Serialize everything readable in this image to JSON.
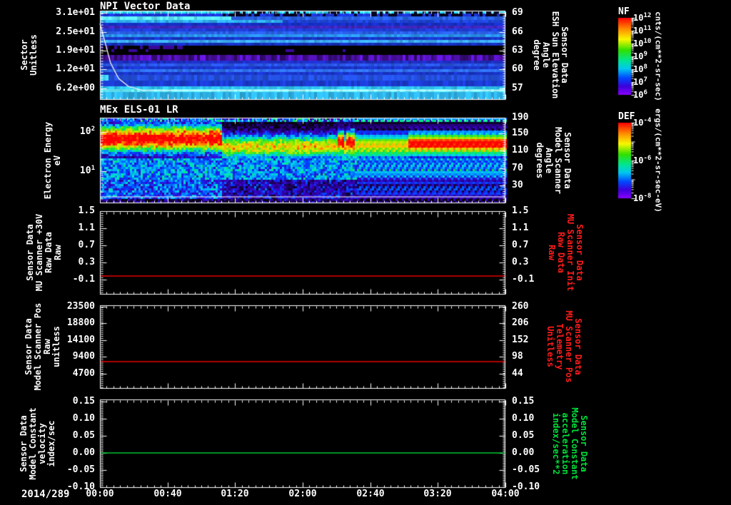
{
  "chart_data": {
    "type": "multi-panel-time-series",
    "time_axis": {
      "date_label": "2014/289",
      "tick_labels": [
        "00:00",
        "00:40",
        "01:20",
        "02:00",
        "02:40",
        "03:20",
        "04:00"
      ],
      "minor_per_major": 10
    },
    "palette": [
      [
        0,
        "#06000a"
      ],
      [
        0.1,
        "#1c0060"
      ],
      [
        0.22,
        "#3a00c8"
      ],
      [
        0.33,
        "#0040ff"
      ],
      [
        0.44,
        "#00b4ff"
      ],
      [
        0.52,
        "#00e6c8"
      ],
      [
        0.6,
        "#00e650"
      ],
      [
        0.7,
        "#7ce800"
      ],
      [
        0.78,
        "#d8ee00"
      ],
      [
        0.86,
        "#ffb400"
      ],
      [
        0.93,
        "#ff5000"
      ],
      [
        1,
        "#ff0000"
      ]
    ],
    "colorbar_gradient": [
      [
        0,
        "#ff0000"
      ],
      [
        0.15,
        "#ff9100"
      ],
      [
        0.28,
        "#f8f800"
      ],
      [
        0.42,
        "#30e000"
      ],
      [
        0.55,
        "#00e690"
      ],
      [
        0.66,
        "#00c8f0"
      ],
      [
        0.78,
        "#0048ff"
      ],
      [
        0.89,
        "#3c00dc"
      ],
      [
        1,
        "#8a00ff"
      ]
    ],
    "colorbars": [
      {
        "title": "NF",
        "units_label": "cnts/(cm**2-sr-sec)",
        "ticks": [
          {
            "label": "10^12",
            "f": 0
          },
          {
            "label": "10^11",
            "f": 0.1667
          },
          {
            "label": "10^10",
            "f": 0.3333
          },
          {
            "label": "10^9",
            "f": 0.5
          },
          {
            "label": "10^8",
            "f": 0.6667
          },
          {
            "label": "10^7",
            "f": 0.8333
          },
          {
            "label": "10^6",
            "f": 1
          }
        ]
      },
      {
        "title": "DEF",
        "units_label": "ergs/(cm**2-sr-sec-eV)",
        "ticks": [
          {
            "label": "10^-4",
            "f": 0
          },
          {
            "label": "10^-6",
            "f": 0.5
          },
          {
            "label": "10^-8",
            "f": 1
          }
        ]
      }
    ],
    "panels": [
      {
        "title": "NPI Vector Data",
        "type": "spectrogram",
        "left_title": "Sector\nUnitless",
        "right_title": "Sensor Data\nESH Sun Elevation\nAngle\ndegree",
        "left_ticks": [
          {
            "label": "3.1e+01",
            "f": 0.024
          },
          {
            "label": "2.5e+01",
            "f": 0.24
          },
          {
            "label": "1.9e+01",
            "f": 0.448
          },
          {
            "label": "1.2e+01",
            "f": 0.656
          },
          {
            "label": "6.2e+00",
            "f": 0.872
          }
        ],
        "right_ticks": [
          {
            "label": "69",
            "f": 0.024
          },
          {
            "label": "66",
            "f": 0.24
          },
          {
            "label": "63",
            "f": 0.448
          },
          {
            "label": "60",
            "f": 0.656
          },
          {
            "label": "57",
            "f": 0.872
          }
        ],
        "rows": [
          {
            "h": 4,
            "c": "#22d2f2",
            "sp": {
              "c": "#000a28",
              "d": 0.55,
              "from": 0.33
            }
          },
          {
            "h": 4,
            "c": "#1b35d8",
            "sp": {
              "c": "#05001e",
              "d": 0.5,
              "from": 0.3
            }
          },
          {
            "h": 5,
            "c": "#5ceaff",
            "c2": "#2a62e8",
            "split": 0.32
          },
          {
            "h": 4,
            "c": "#2fb0f2",
            "c2": "#1e45d8",
            "split": 0.45
          },
          {
            "h": 4,
            "c": "#1530c8"
          },
          {
            "h": 4,
            "c": "#3f28c0"
          },
          {
            "h": 4,
            "c": "#1e3ed8"
          },
          {
            "h": 4,
            "c": "#2a60e8"
          },
          {
            "h": 4,
            "c": "#2b96f2"
          },
          {
            "h": 4,
            "c": "#1636cc"
          },
          {
            "h": 4,
            "c": "#3dacf6"
          },
          {
            "h": 4,
            "c": "#1530bc"
          },
          {
            "h": 5,
            "c": "#000000",
            "sp": {
              "c": "#38089a",
              "d": 0.55,
              "to": 0.23
            }
          },
          {
            "h": 4,
            "c": "#000000",
            "sp": {
              "c": "#38089a",
              "d": 0.1,
              "to": 0.6
            }
          },
          {
            "h": 4,
            "c": "#000000"
          },
          {
            "h": 8,
            "c": "#4c10a8",
            "n": 0.5
          },
          {
            "h": 4,
            "c": "#1d2fc4"
          },
          {
            "h": 4,
            "c": "#2a55e4"
          },
          {
            "h": 4,
            "c": "#1a35cc"
          },
          {
            "h": 4,
            "c": "#2f70f0"
          },
          {
            "h": 4,
            "c": "#1a35cc"
          },
          {
            "h": 8,
            "c": "#2450e0",
            "lead": "#3fd4f8",
            "leadW": 0.018
          },
          {
            "h": 8,
            "c": "#1c3cd4"
          },
          {
            "h": 4,
            "c": "#2fc4f2"
          },
          {
            "h": 4,
            "c": "#63eeff"
          },
          {
            "h": 11,
            "c": "#2fb4ea"
          }
        ],
        "overlay_line": {
          "color": "#ffffff",
          "points": [
            [
              0,
              0.144
            ],
            [
              0.012,
              0.344
            ],
            [
              0.026,
              0.584
            ],
            [
              0.046,
              0.76
            ],
            [
              0.07,
              0.848
            ],
            [
              0.105,
              0.894
            ],
            [
              1,
              0.894
            ]
          ]
        }
      },
      {
        "title": "MEx ELS-01 LR",
        "type": "spectrogram",
        "left_title": "Electron Energy\neV",
        "right_title": "Sensor Data\nModel Scanner\nAngle\ndegrees",
        "left_ticks": [
          {
            "label": "10^2",
            "f": 0.167
          },
          {
            "label": "10^1",
            "f": 0.625
          }
        ],
        "right_ticks": [
          {
            "label": "190",
            "f": 0
          },
          {
            "label": "150",
            "f": 0.183
          },
          {
            "label": "110",
            "f": 0.383
          },
          {
            "label": "70",
            "f": 0.592
          },
          {
            "label": "30",
            "f": 0.792
          }
        ],
        "bands": [
          {
            "x0": 0,
            "x1": 0.3,
            "center": 0.235,
            "hw": 0.17,
            "peak": 1.05
          },
          {
            "x0": 0.3,
            "x1": 0.76,
            "center": 0.33,
            "hw": 0.15,
            "peak": 0.8
          },
          {
            "x0": 0.585,
            "x1": 0.6,
            "center": 0.27,
            "hw": 0.13,
            "peak": 1.05
          },
          {
            "x0": 0.605,
            "x1": 0.625,
            "center": 0.27,
            "hw": 0.13,
            "peak": 1.05
          },
          {
            "x0": 0.76,
            "x1": 1,
            "center": 0.305,
            "hw": 0.14,
            "peak": 1.0
          }
        ],
        "overlay_line": {
          "color": "#ffffff",
          "f": 0.925
        }
      },
      {
        "type": "line",
        "left_title": "Sensor Data\nMU Scanner +30V\nRaw Data\nRaw",
        "right_title": "Sensor Data\nMU Scanner Init\nRaw Data\nRaw",
        "right_color": "#ff1c1c",
        "left_ticks": [
          {
            "label": "1.5",
            "f": 0
          },
          {
            "label": "1.1",
            "f": 0.205
          },
          {
            "label": "0.7",
            "f": 0.41
          },
          {
            "label": "0.3",
            "f": 0.615
          },
          {
            "label": "-0.1",
            "f": 0.821
          }
        ],
        "right_ticks": [
          {
            "label": "1.5",
            "f": 0
          },
          {
            "label": "1.1",
            "f": 0.205
          },
          {
            "label": "0.7",
            "f": 0.41
          },
          {
            "label": "0.3",
            "f": 0.615
          },
          {
            "label": "-0.1",
            "f": 0.821
          }
        ],
        "series": {
          "color": "#e80000",
          "value": 0.0,
          "f": 0.778
        }
      },
      {
        "type": "line",
        "left_title": "Sensor Data\nModel Scanner Pos\nRaw\nunitless",
        "right_title": "Sensor Data\nMU Scanner Pos\nTelemetry\nUnitless",
        "right_color": "#ff1c1c",
        "left_ticks": [
          {
            "label": "23500",
            "f": 0.017
          },
          {
            "label": "18800",
            "f": 0.214
          },
          {
            "label": "14100",
            "f": 0.419
          },
          {
            "label": "9400",
            "f": 0.615
          },
          {
            "label": "4700",
            "f": 0.821
          }
        ],
        "right_ticks": [
          {
            "label": "260",
            "f": 0.017
          },
          {
            "label": "206",
            "f": 0.214
          },
          {
            "label": "152",
            "f": 0.419
          },
          {
            "label": "98",
            "f": 0.615
          },
          {
            "label": "44",
            "f": 0.821
          }
        ],
        "series": {
          "color": "#e80000",
          "value": 8000,
          "f": 0.675
        }
      },
      {
        "type": "line",
        "left_title": "Sensor Data\nModel Constant\nvelocity\nindex/sec",
        "right_title": "Sensor Data\nModel Constant\nacceleration\nindex/sec**2",
        "right_color": "#00e03c",
        "left_ticks": [
          {
            "label": "0.15",
            "f": 0.024
          },
          {
            "label": "0.10",
            "f": 0.218
          },
          {
            "label": "0.05",
            "f": 0.411
          },
          {
            "label": "0.00",
            "f": 0.605
          },
          {
            "label": "-0.05",
            "f": 0.798
          },
          {
            "label": "-0.10",
            "f": 0.992
          }
        ],
        "right_ticks": [
          {
            "label": "0.15",
            "f": 0.024
          },
          {
            "label": "0.10",
            "f": 0.218
          },
          {
            "label": "0.05",
            "f": 0.411
          },
          {
            "label": "0.00",
            "f": 0.605
          },
          {
            "label": "-0.05",
            "f": 0.798
          },
          {
            "label": "-0.10",
            "f": 0.992
          }
        ],
        "series": {
          "color": "#00c832",
          "value": 0.0,
          "f": 0.605
        }
      }
    ]
  }
}
